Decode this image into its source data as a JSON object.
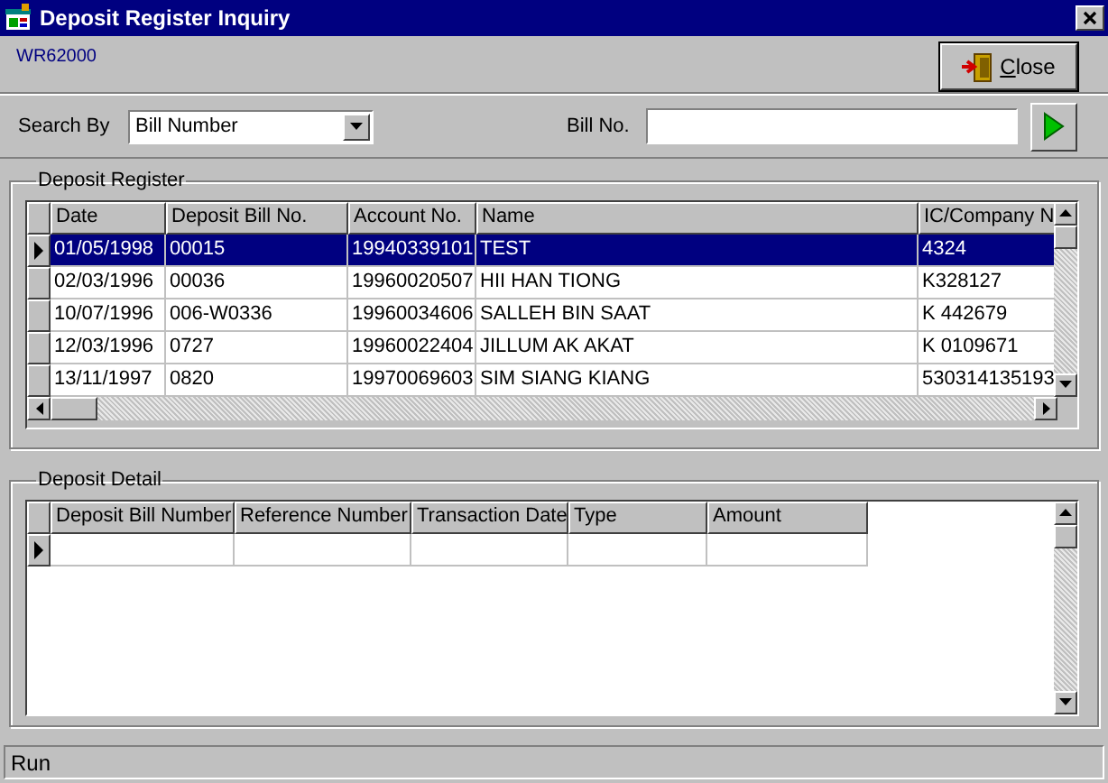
{
  "window": {
    "title": "Deposit Register Inquiry"
  },
  "form_code": "WR62000",
  "close_button": {
    "label": "Close",
    "access_key_underlined": true
  },
  "search": {
    "label": "Search By",
    "value": "Bill Number",
    "bill_label": "Bill No."
  },
  "register": {
    "title": "Deposit Register",
    "columns": [
      "Date",
      "Deposit Bill No.",
      "Account No.",
      "Name",
      "IC/Company N"
    ],
    "rows": [
      {
        "cells": [
          "01/05/1998",
          "00015",
          "19940339101",
          "TEST",
          "4324"
        ],
        "selected": true
      },
      {
        "cells": [
          "02/03/1996",
          "00036",
          "19960020507",
          "HII HAN TIONG",
          "K328127"
        ],
        "selected": false
      },
      {
        "cells": [
          "10/07/1996",
          "006-W0336",
          "19960034606",
          "SALLEH BIN SAAT",
          "K 442679"
        ],
        "selected": false
      },
      {
        "cells": [
          "12/03/1996",
          "0727",
          "19960022404",
          "JILLUM AK AKAT",
          "K 0109671"
        ],
        "selected": false
      },
      {
        "cells": [
          "13/11/1997",
          "0820",
          "19970069603",
          "SIM SIANG KIANG",
          "530314135193"
        ],
        "selected": false
      }
    ]
  },
  "detail": {
    "title": "Deposit Detail",
    "columns": [
      "Deposit Bill Number",
      "Reference Number",
      "Transaction Date",
      "Type",
      "Amount"
    ],
    "current_row_indicator": true
  },
  "status_bar": {
    "text": "Run"
  }
}
